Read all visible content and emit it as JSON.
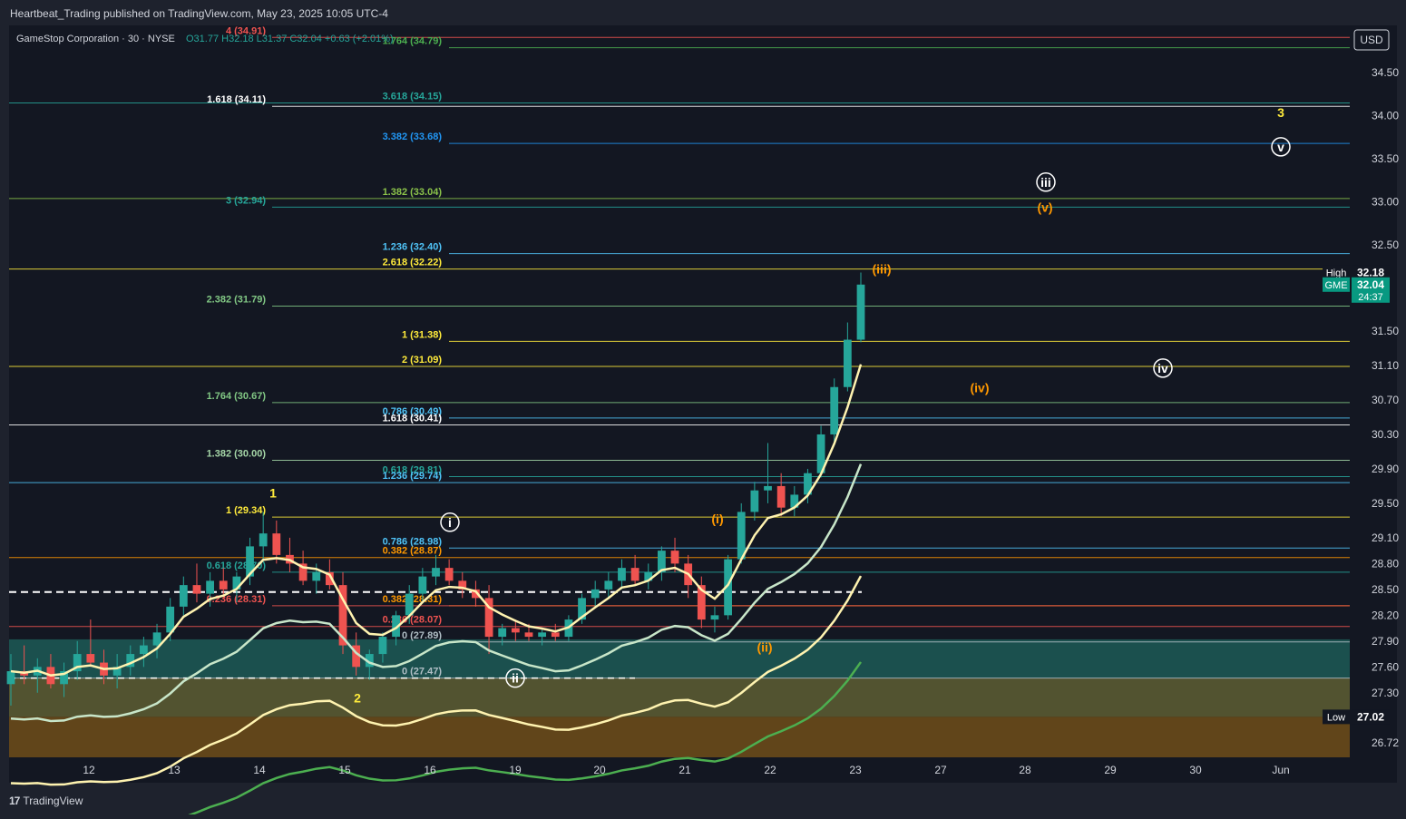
{
  "header": {
    "published": "Heartbeat_Trading published on TradingView.com, May 23, 2025 10:05 UTC-4",
    "symbol_line": "GameStop Corporation · 30 · NYSE",
    "ohlc": "O31.77 H32.18 L31.37 C32.04 +0.63 (+2.01%)"
  },
  "footer": {
    "brand": "TradingView",
    "logo": "tv-logo-icon"
  },
  "colors": {
    "bg": "#131722",
    "frame": "#1e222d",
    "up": "#26a69a",
    "down": "#ef5350",
    "grid": "#363a45"
  },
  "chart_data": {
    "type": "candlestick",
    "currency": "USD",
    "ylim": [
      26.55,
      35.05
    ],
    "y_ticks": [
      34.5,
      34.0,
      33.5,
      33.0,
      32.5,
      31.5,
      31.1,
      30.7,
      30.3,
      29.9,
      29.5,
      29.1,
      28.8,
      28.5,
      28.2,
      27.9,
      27.6,
      27.3,
      26.72
    ],
    "x_ticks": [
      "12",
      "13",
      "14",
      "15",
      "16",
      "19",
      "20",
      "21",
      "22",
      "23",
      "27",
      "28",
      "29",
      "30",
      "Jun"
    ],
    "price_badges": [
      {
        "label": "High",
        "value": "32.18",
        "price": 32.18,
        "color": "#131722"
      },
      {
        "label": "GME",
        "value": "32.04",
        "sub": "24:37",
        "price": 32.04,
        "color": "#089981"
      },
      {
        "label": "Low",
        "value": "27.02",
        "price": 27.02,
        "color": "#131722"
      }
    ],
    "candles": [
      [
        27.4,
        27.75,
        27.15,
        27.55
      ],
      [
        27.55,
        27.85,
        27.4,
        27.5
      ],
      [
        27.5,
        27.7,
        27.3,
        27.6
      ],
      [
        27.6,
        27.75,
        27.35,
        27.4
      ],
      [
        27.4,
        27.65,
        27.25,
        27.55
      ],
      [
        27.55,
        27.9,
        27.45,
        27.75
      ],
      [
        27.75,
        28.15,
        27.6,
        27.65
      ],
      [
        27.65,
        27.8,
        27.4,
        27.5
      ],
      [
        27.5,
        27.75,
        27.35,
        27.6
      ],
      [
        27.6,
        27.85,
        27.5,
        27.75
      ],
      [
        27.75,
        27.95,
        27.6,
        27.85
      ],
      [
        27.85,
        28.1,
        27.7,
        28.0
      ],
      [
        28.0,
        28.4,
        27.9,
        28.3
      ],
      [
        28.3,
        28.65,
        28.2,
        28.55
      ],
      [
        28.55,
        28.8,
        28.35,
        28.45
      ],
      [
        28.45,
        28.7,
        28.3,
        28.6
      ],
      [
        28.6,
        28.75,
        28.4,
        28.5
      ],
      [
        28.5,
        28.7,
        28.35,
        28.65
      ],
      [
        28.65,
        29.1,
        28.55,
        29.0
      ],
      [
        29.0,
        29.4,
        28.85,
        29.15
      ],
      [
        29.15,
        29.3,
        28.8,
        28.9
      ],
      [
        28.9,
        29.1,
        28.7,
        28.8
      ],
      [
        28.8,
        28.95,
        28.55,
        28.6
      ],
      [
        28.6,
        28.8,
        28.45,
        28.7
      ],
      [
        28.7,
        28.85,
        28.5,
        28.55
      ],
      [
        28.55,
        28.7,
        27.75,
        27.85
      ],
      [
        27.85,
        28.0,
        27.5,
        27.6
      ],
      [
        27.6,
        27.8,
        27.45,
        27.75
      ],
      [
        27.75,
        28.0,
        27.65,
        27.95
      ],
      [
        27.95,
        28.25,
        27.85,
        28.2
      ],
      [
        28.2,
        28.55,
        28.1,
        28.45
      ],
      [
        28.45,
        28.75,
        28.35,
        28.65
      ],
      [
        28.65,
        28.9,
        28.55,
        28.75
      ],
      [
        28.75,
        28.85,
        28.55,
        28.6
      ],
      [
        28.6,
        28.7,
        28.4,
        28.5
      ],
      [
        28.5,
        28.6,
        28.3,
        28.4
      ],
      [
        28.4,
        28.55,
        27.75,
        27.95
      ],
      [
        27.95,
        28.1,
        27.85,
        28.05
      ],
      [
        28.05,
        28.15,
        27.9,
        28.0
      ],
      [
        28.0,
        28.1,
        27.9,
        27.95
      ],
      [
        27.95,
        28.05,
        27.85,
        28.0
      ],
      [
        28.0,
        28.1,
        27.9,
        27.95
      ],
      [
        27.95,
        28.2,
        27.9,
        28.15
      ],
      [
        28.15,
        28.45,
        28.1,
        28.4
      ],
      [
        28.4,
        28.6,
        28.3,
        28.5
      ],
      [
        28.5,
        28.7,
        28.4,
        28.6
      ],
      [
        28.6,
        28.85,
        28.5,
        28.75
      ],
      [
        28.75,
        28.9,
        28.55,
        28.6
      ],
      [
        28.6,
        28.8,
        28.5,
        28.7
      ],
      [
        28.7,
        29.0,
        28.6,
        28.95
      ],
      [
        28.95,
        29.1,
        28.7,
        28.8
      ],
      [
        28.8,
        28.9,
        28.4,
        28.55
      ],
      [
        28.55,
        28.65,
        28.05,
        28.15
      ],
      [
        28.15,
        28.3,
        28.0,
        28.2
      ],
      [
        28.2,
        28.9,
        28.15,
        28.85
      ],
      [
        28.85,
        29.5,
        28.8,
        29.4
      ],
      [
        29.4,
        29.75,
        29.3,
        29.65
      ],
      [
        29.65,
        30.2,
        29.5,
        29.7
      ],
      [
        29.7,
        29.85,
        29.35,
        29.45
      ],
      [
        29.45,
        29.7,
        29.35,
        29.6
      ],
      [
        29.6,
        29.9,
        29.5,
        29.85
      ],
      [
        29.85,
        30.4,
        29.8,
        30.3
      ],
      [
        30.3,
        30.95,
        30.2,
        30.85
      ],
      [
        30.85,
        31.6,
        30.8,
        31.4
      ],
      [
        31.4,
        32.18,
        31.37,
        32.04
      ]
    ],
    "fib_levels": [
      {
        "label": "4 (34.91)",
        "price": 34.91,
        "color": "#ef5350"
      },
      {
        "label": "1.764 (34.79)",
        "price": 34.79,
        "color": "#4caf50"
      },
      {
        "label": "3.618 (34.15)",
        "price": 34.15,
        "color": "#26a69a"
      },
      {
        "label": "1.618 (34.11)",
        "price": 34.11,
        "color": "#ffffff"
      },
      {
        "label": "3.382 (33.68)",
        "price": 33.68,
        "color": "#2196f3"
      },
      {
        "label": "1.382 (33.04)",
        "price": 33.04,
        "color": "#8bc34a"
      },
      {
        "label": "3 (32.94)",
        "price": 32.94,
        "color": "#26a69a"
      },
      {
        "label": "1.236 (32.40)",
        "price": 32.4,
        "color": "#4fc3f7"
      },
      {
        "label": "2.618 (32.22)",
        "price": 32.22,
        "color": "#ffeb3b"
      },
      {
        "label": "2.382 (31.79)",
        "price": 31.79,
        "color": "#81c784"
      },
      {
        "label": "1 (31.38)",
        "price": 31.38,
        "color": "#ffeb3b"
      },
      {
        "label": "2 (31.09)",
        "price": 31.09,
        "color": "#ffeb3b"
      },
      {
        "label": "1.764 (30.67)",
        "price": 30.67,
        "color": "#81c784"
      },
      {
        "label": "0.786 (30.49)",
        "price": 30.49,
        "color": "#4fc3f7"
      },
      {
        "label": "1.618 (30.41)",
        "price": 30.41,
        "color": "#ffffff"
      },
      {
        "label": "1.382 (30.00)",
        "price": 30.0,
        "color": "#a5d6a7"
      },
      {
        "label": "0.618 (29.81)",
        "price": 29.81,
        "color": "#26a69a"
      },
      {
        "label": "1.236 (29.74)",
        "price": 29.74,
        "color": "#4fc3f7"
      },
      {
        "label": "1 (29.34)",
        "price": 29.34,
        "color": "#ffeb3b"
      },
      {
        "label": "0.786 (28.98)",
        "price": 28.98,
        "color": "#4fc3f7"
      },
      {
        "label": "0.382 (28.87)",
        "price": 28.87,
        "color": "#ff9800"
      },
      {
        "label": "0.618 (28.70)",
        "price": 28.7,
        "color": "#26a69a"
      },
      {
        "label": "0.382 (28.31)",
        "price": 28.31,
        "color": "#ff9800"
      },
      {
        "label": "0.236 (28.07)",
        "price": 28.07,
        "color": "#ef5350"
      },
      {
        "label": "0.236 (28.31)",
        "price": 28.31,
        "color": "#ef5350"
      },
      {
        "label": "0 (27.89)",
        "price": 27.89,
        "color": "#b0bec5"
      },
      {
        "label": "0 (27.47)",
        "price": 27.47,
        "color": "#b0bec5"
      }
    ],
    "wave_labels": [
      {
        "text": "1",
        "price": 29.62,
        "color": "#ffeb3b",
        "circled": false
      },
      {
        "text": "2",
        "price": 27.24,
        "color": "#ffeb3b",
        "circled": false
      },
      {
        "text": "3",
        "price": 34.04,
        "color": "#ffeb3b",
        "circled": false
      },
      {
        "text": "i",
        "price": 29.28,
        "color": "#ffffff",
        "circled": true
      },
      {
        "text": "ii",
        "price": 27.47,
        "color": "#ffffff",
        "circled": true
      },
      {
        "text": "iii",
        "price": 33.23,
        "color": "#ffffff",
        "circled": true
      },
      {
        "text": "iv",
        "price": 31.07,
        "color": "#ffffff",
        "circled": true
      },
      {
        "text": "v",
        "price": 33.64,
        "color": "#ffffff",
        "circled": true
      },
      {
        "text": "(i)",
        "price": 29.32,
        "color": "#ff9800",
        "circled": false
      },
      {
        "text": "(ii)",
        "price": 27.83,
        "color": "#ff9800",
        "circled": false
      },
      {
        "text": "(iii)",
        "price": 32.22,
        "color": "#ff9800",
        "circled": false
      },
      {
        "text": "(iv)",
        "price": 30.84,
        "color": "#ff9800",
        "circled": false
      },
      {
        "text": "(v)",
        "price": 32.94,
        "color": "#ff9800",
        "circled": false
      }
    ]
  }
}
